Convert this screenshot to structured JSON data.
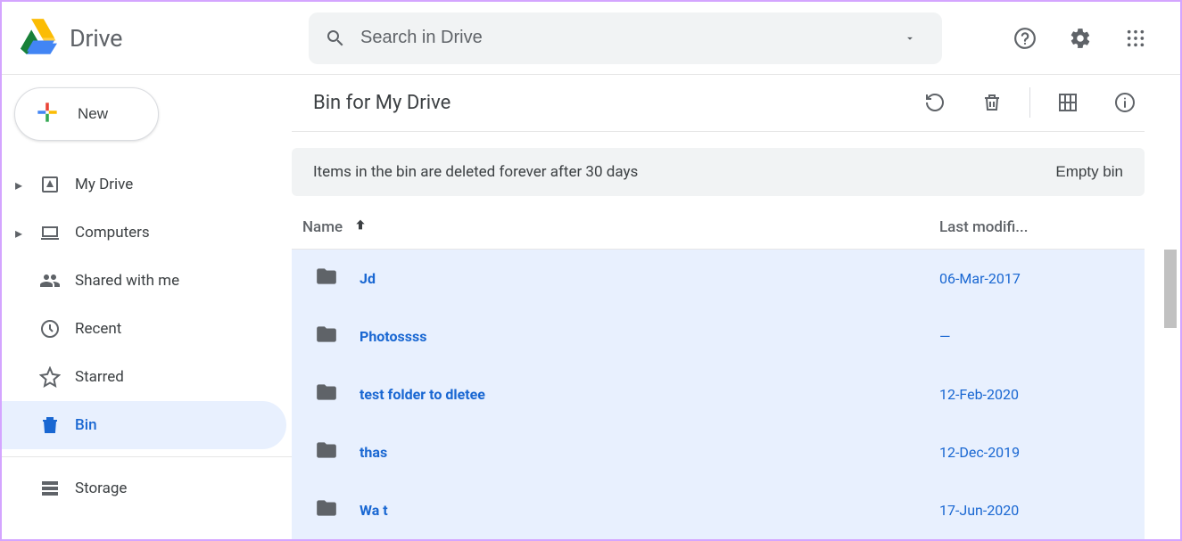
{
  "app_name": "Drive",
  "search": {
    "placeholder": "Search in Drive"
  },
  "new_button": "New",
  "nav": {
    "my_drive": "My Drive",
    "computers": "Computers",
    "shared": "Shared with me",
    "recent": "Recent",
    "starred": "Starred",
    "bin": "Bin",
    "storage": "Storage"
  },
  "main": {
    "title": "Bin for My Drive",
    "banner_msg": "Items in the bin are deleted forever after 30 days",
    "empty_bin": "Empty bin",
    "col_name": "Name",
    "col_date": "Last modifi..."
  },
  "rows": [
    {
      "name": "Jd",
      "date": "06-Mar-2017"
    },
    {
      "name": "Photossss",
      "date": "—"
    },
    {
      "name": "test folder to dletee",
      "date": "12-Feb-2020"
    },
    {
      "name": "thas",
      "date": "12-Dec-2019"
    },
    {
      "name": "Wa t",
      "date": "17-Jun-2020"
    }
  ]
}
